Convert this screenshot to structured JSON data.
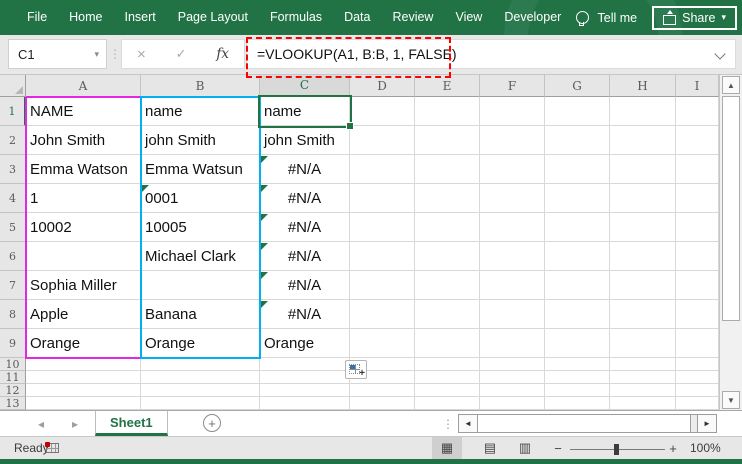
{
  "ribbon": {
    "tabs": [
      "File",
      "Home",
      "Insert",
      "Page Layout",
      "Formulas",
      "Data",
      "Review",
      "View",
      "Developer"
    ],
    "tell_me_label": "Tell me",
    "share_label": "Share"
  },
  "formula_bar": {
    "name_box_value": "C1",
    "formula": "=VLOOKUP(A1, B:B, 1, FALSE)"
  },
  "grid": {
    "column_headers": [
      "A",
      "B",
      "C",
      "D",
      "E",
      "F",
      "G",
      "H",
      "I"
    ],
    "row_count": 13,
    "selected_cell": "C1",
    "cell_values": {
      "A": [
        "NAME",
        "John Smith",
        "Emma Watson",
        "1",
        "10002",
        "",
        "Sophia Miller",
        "Apple",
        "Orange"
      ],
      "B": [
        "name",
        "john Smith",
        "Emma Watsun",
        "0001",
        "10005",
        "Michael Clark",
        "",
        "Banana",
        "Orange"
      ],
      "C": [
        "name",
        "john Smith",
        "#N/A",
        "#N/A",
        "#N/A",
        "#N/A",
        "#N/A",
        "#N/A",
        "Orange"
      ]
    },
    "error_indicator_cells": [
      "B4",
      "C3",
      "C4",
      "C5",
      "C6",
      "C7",
      "C8"
    ],
    "highlight_ranges": [
      {
        "range": "A1:A9",
        "color": "#e526e5"
      },
      {
        "range": "B1:B9",
        "color": "#00b0f0"
      }
    ]
  },
  "sheet_tabs": {
    "tabs": [
      {
        "label": "Sheet1",
        "active": true
      }
    ]
  },
  "status_bar": {
    "status": "Ready",
    "zoom_level": "100%"
  },
  "icons": {
    "cancel": "×",
    "enter": "✓",
    "fx": "fx",
    "namebox_dropdown": "▾",
    "share_dropdown": "▾",
    "sheet_nav_left": "◂",
    "sheet_nav_right": "▸",
    "add_sheet": "+",
    "overflow_dots": "⋮",
    "scroll_up": "▲",
    "scroll_down": "▼",
    "scroll_left": "◄",
    "scroll_right": "►",
    "view_normal": "▦",
    "view_page_layout": "▤",
    "view_page_break": "▥",
    "zoom_out": "−",
    "zoom_in": "+"
  },
  "colors": {
    "excel_green": "#217346",
    "annotation_red": "#ff0000",
    "range_a": "#e526e5",
    "range_b": "#00b0f0"
  }
}
